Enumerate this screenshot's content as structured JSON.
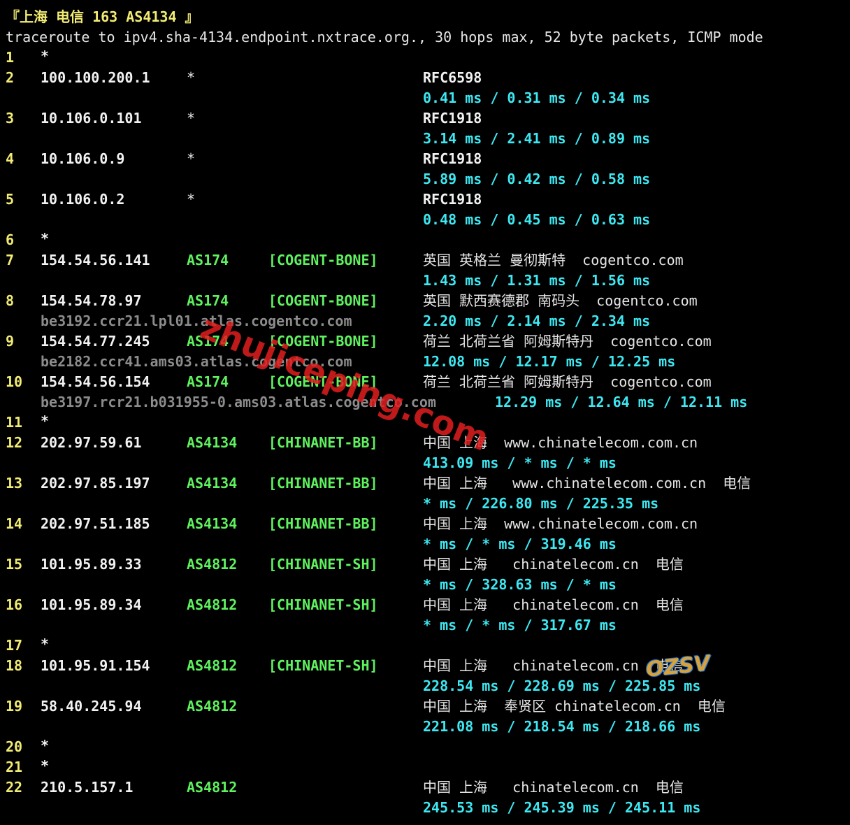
{
  "colors": {
    "background": "#000000",
    "hop_number": "#f2ec74",
    "ip": "#f2f2f2",
    "asn": "#5ff25f",
    "latency": "#3de8f2",
    "hostname": "#8c8c8c",
    "watermark": "#e11e1e"
  },
  "header": {
    "title": "『上海 电信 163 AS4134 』",
    "command": "traceroute to ipv4.sha-4134.endpoint.nxtrace.org., 30 hops max, 52 byte packets, ICMP mode"
  },
  "hops": [
    {
      "n": "1",
      "ip": "*"
    },
    {
      "n": "2",
      "ip": "100.100.200.1",
      "asn": "*",
      "geo": "RFC6598",
      "latency": "0.41 ms / 0.31 ms / 0.34 ms"
    },
    {
      "n": "3",
      "ip": "10.106.0.101",
      "asn": "*",
      "geo": "RFC1918",
      "latency": "3.14 ms / 2.41 ms / 0.89 ms"
    },
    {
      "n": "4",
      "ip": "10.106.0.9",
      "asn": "*",
      "geo": "RFC1918",
      "latency": "5.89 ms / 0.42 ms / 0.58 ms"
    },
    {
      "n": "5",
      "ip": "10.106.0.2",
      "asn": "*",
      "geo": "RFC1918",
      "latency": "0.48 ms / 0.45 ms / 0.63 ms"
    },
    {
      "n": "6",
      "ip": "*"
    },
    {
      "n": "7",
      "ip": "154.54.56.141",
      "asn": "AS174",
      "net": "[COGENT-BONE]",
      "geo": "英国 英格兰 曼彻斯特  cogentco.com",
      "latency": "1.43 ms / 1.31 ms / 1.56 ms"
    },
    {
      "n": "8",
      "ip": "154.54.78.97",
      "asn": "AS174",
      "net": "[COGENT-BONE]",
      "geo": "英国 默西赛德郡 南码头  cogentco.com",
      "host": "be3192.ccr21.lpl01.atlas.cogentco.com",
      "latency": "2.20 ms / 2.14 ms / 2.34 ms"
    },
    {
      "n": "9",
      "ip": "154.54.77.245",
      "asn": "AS174",
      "net": "[COGENT-BONE]",
      "geo": "荷兰 北荷兰省 阿姆斯特丹  cogentco.com",
      "host": "be2182.ccr41.ams03.atlas.cogentco.com",
      "latency": "12.08 ms / 12.17 ms / 12.25 ms"
    },
    {
      "n": "10",
      "ip": "154.54.56.154",
      "asn": "AS174",
      "net": "[COGENT-BONE]",
      "geo": "荷兰 北荷兰省 阿姆斯特丹  cogentco.com",
      "host": "be3197.rcr21.b031955-0.ams03.atlas.cogentco.com",
      "latency": "12.29 ms / 12.64 ms / 12.11 ms"
    },
    {
      "n": "11",
      "ip": "*"
    },
    {
      "n": "12",
      "ip": "202.97.59.61",
      "asn": "AS4134",
      "net": "[CHINANET-BB]",
      "geo": "中国 上海  www.chinatelecom.com.cn",
      "latency": "413.09 ms / * ms / * ms"
    },
    {
      "n": "13",
      "ip": "202.97.85.197",
      "asn": "AS4134",
      "net": "[CHINANET-BB]",
      "geo": "中国 上海   www.chinatelecom.com.cn  电信",
      "latency": "* ms / 226.80 ms / 225.35 ms"
    },
    {
      "n": "14",
      "ip": "202.97.51.185",
      "asn": "AS4134",
      "net": "[CHINANET-BB]",
      "geo": "中国 上海  www.chinatelecom.com.cn",
      "latency": "* ms / * ms / 319.46 ms"
    },
    {
      "n": "15",
      "ip": "101.95.89.33",
      "asn": "AS4812",
      "net": "[CHINANET-SH]",
      "geo": "中国 上海   chinatelecom.cn  电信",
      "latency": "* ms / 328.63 ms / * ms"
    },
    {
      "n": "16",
      "ip": "101.95.89.34",
      "asn": "AS4812",
      "net": "[CHINANET-SH]",
      "geo": "中国 上海   chinatelecom.cn  电信",
      "latency": "* ms / * ms / 317.67 ms"
    },
    {
      "n": "17",
      "ip": "*"
    },
    {
      "n": "18",
      "ip": "101.95.91.154",
      "asn": "AS4812",
      "net": "[CHINANET-SH]",
      "geo": "中国 上海   chinatelecom.cn  电信",
      "latency": "228.54 ms / 228.69 ms / 225.85 ms"
    },
    {
      "n": "19",
      "ip": "58.40.245.94",
      "asn": "AS4812",
      "geo": "中国 上海  奉贤区 chinatelecom.cn  电信",
      "latency": "221.08 ms / 218.54 ms / 218.66 ms"
    },
    {
      "n": "20",
      "ip": "*"
    },
    {
      "n": "21",
      "ip": "*"
    },
    {
      "n": "22",
      "ip": "210.5.157.1",
      "asn": "AS4812",
      "geo": "中国 上海   chinatelecom.cn  电信",
      "latency": "245.53 ms / 245.39 ms / 245.11 ms"
    }
  ],
  "watermark": {
    "text": "zhujiceping.com",
    "logo": "OZSV"
  }
}
